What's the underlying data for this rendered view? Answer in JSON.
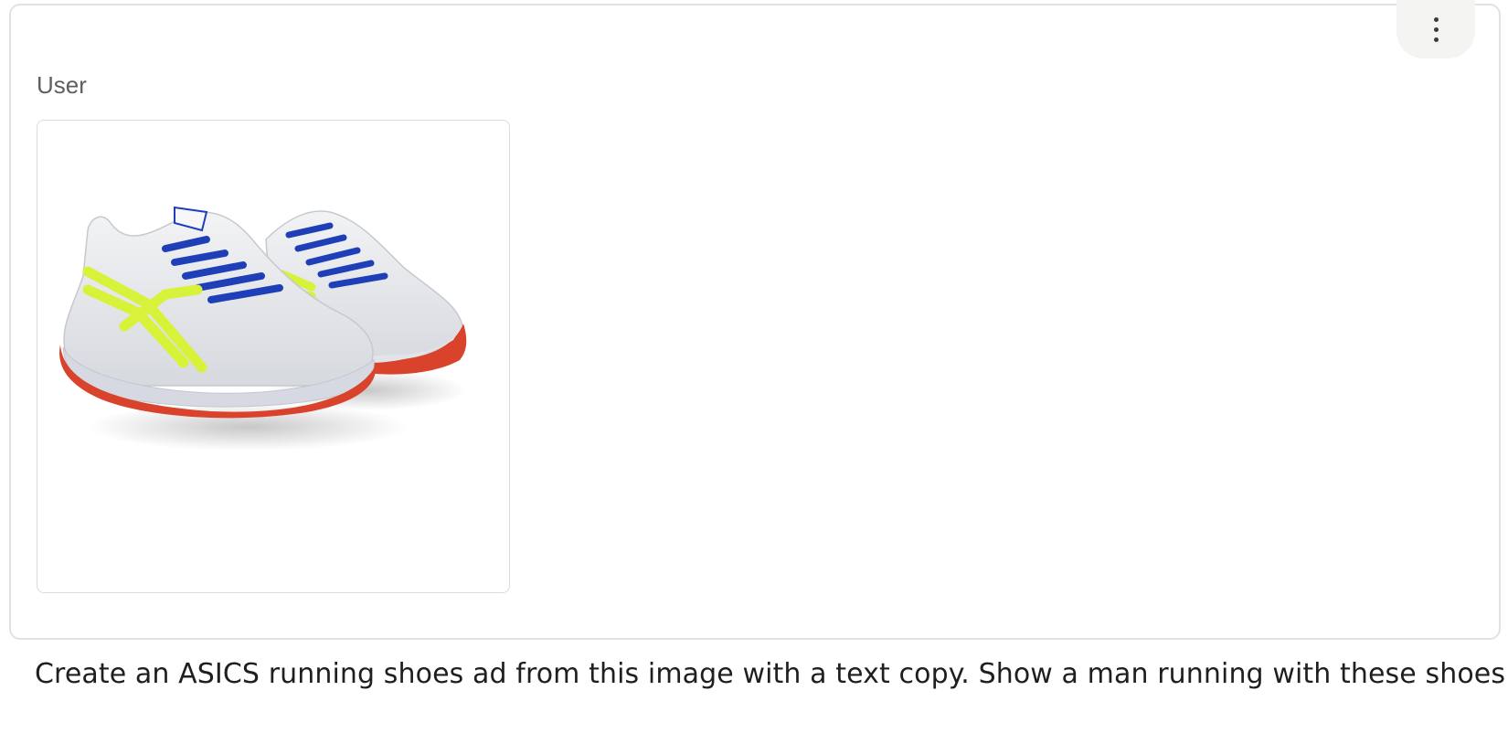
{
  "message": {
    "role_label": "User",
    "menu_icon": "more-vertical-icon",
    "attachment": {
      "kind": "image",
      "description_icon": "running-shoes-image",
      "colors": {
        "upper": "#e4e6e9",
        "stripes": "#d8f23a",
        "laces": "#1f3fb8",
        "outsole": "#d9432c",
        "midsole": "#d7d9e2"
      }
    },
    "text": "Create an ASICS running shoes ad from this image with a text copy. Show a man running with these shoes."
  }
}
